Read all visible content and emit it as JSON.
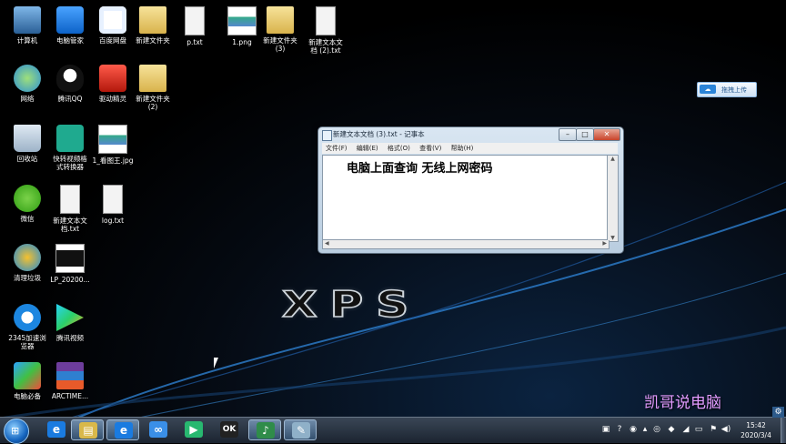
{
  "desktop": {
    "icons": [
      {
        "label": "计算机",
        "icon": "computer-icon"
      },
      {
        "label": "电脑管家",
        "icon": "shield-icon"
      },
      {
        "label": "百度网盘",
        "icon": "cloud-icon"
      },
      {
        "label": "新建文件夹",
        "icon": "folder-icon"
      },
      {
        "label": "p.txt",
        "icon": "text-file-icon"
      },
      {
        "label": "1.png",
        "icon": "image-file-icon"
      },
      {
        "label": "新建文件夹 (3)",
        "icon": "folder-icon"
      },
      {
        "label": "新建文本文 档 (2).txt",
        "icon": "text-file-icon"
      },
      {
        "label": "网络",
        "icon": "network-icon"
      },
      {
        "label": "腾讯QQ",
        "icon": "penguin-icon"
      },
      {
        "label": "驱动精灵",
        "icon": "driver-icon"
      },
      {
        "label": "新建文件夹 (2)",
        "icon": "folder-icon"
      },
      {
        "label": "回收站",
        "icon": "recycle-bin-icon"
      },
      {
        "label": "快转视频格 式转换器",
        "icon": "converter-icon"
      },
      {
        "label": "1_看图王.jpg",
        "icon": "image-file-icon"
      },
      {
        "label": "微信",
        "icon": "wechat-icon"
      },
      {
        "label": "新建文本文 档.txt",
        "icon": "text-file-icon"
      },
      {
        "label": "log.txt",
        "icon": "text-file-icon"
      },
      {
        "label": "清理垃圾",
        "icon": "cleaner-icon"
      },
      {
        "label": "LP_20200...",
        "icon": "video-file-icon"
      },
      {
        "label": "2345加速浏 览器",
        "icon": "browser-icon"
      },
      {
        "label": "腾讯视频",
        "icon": "video-player-icon"
      },
      {
        "label": "电脑必备",
        "icon": "toolbox-icon"
      },
      {
        "label": "ARCTIME...",
        "icon": "archive-icon"
      }
    ],
    "xps_logo": "XPS",
    "upload_button": "拖拽上传",
    "watermark": "凯哥说电脑"
  },
  "notepad": {
    "title": "新建文本文档 (3).txt - 记事本",
    "minimize": "–",
    "maximize": "□",
    "close": "✕",
    "menus": [
      "文件(F)",
      "编辑(E)",
      "格式(O)",
      "查看(V)",
      "帮助(H)"
    ],
    "content": "电脑上面查询 无线上网密码"
  },
  "taskbar": {
    "start_label": "⊞",
    "items": [
      {
        "icon": "ie-icon",
        "glyph": "e",
        "active": false
      },
      {
        "icon": "file-explorer-icon",
        "glyph": "▤",
        "active": true
      },
      {
        "icon": "ie-window-icon",
        "glyph": "e",
        "active": true
      },
      {
        "icon": "baidu-netdisk-icon",
        "glyph": "∞",
        "active": false
      },
      {
        "icon": "tencent-video-icon",
        "glyph": "▶",
        "active": false
      },
      {
        "icon": "recorder-icon",
        "glyph": "OK",
        "active": false
      },
      {
        "icon": "music-icon",
        "glyph": "♪",
        "active": true
      },
      {
        "icon": "notepad-icon",
        "glyph": "✎",
        "active": true
      }
    ],
    "clock_time": "15:42",
    "clock_date": "2020/3/4"
  }
}
